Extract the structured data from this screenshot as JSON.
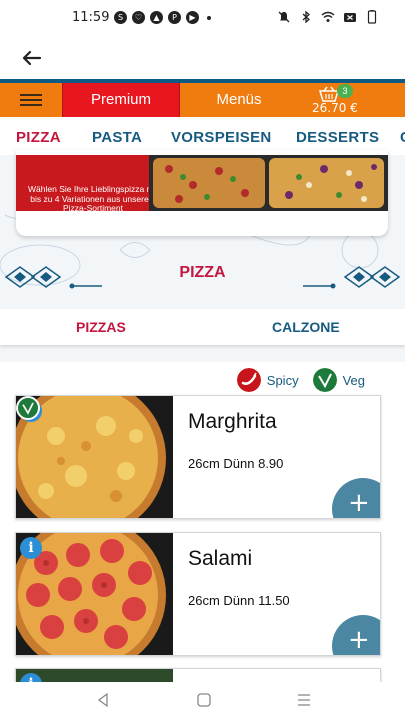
{
  "status_bar": {
    "time": "11:59",
    "apps": [
      "S",
      "♡",
      "▲",
      "P",
      "▶"
    ]
  },
  "navbar": {
    "premium_label": "Premium",
    "menus_label": "Menüs",
    "cart_count": "3",
    "cart_total": "26.70 €"
  },
  "categories": [
    "PIZZA",
    "PASTA",
    "VORSPEISEN",
    "DESSERTS"
  ],
  "banner": {
    "text": "Wählen Sie Ihre Lieblingspizza mit bis zu 4 Variationen aus unserem Pizza-Sortiment"
  },
  "section": {
    "title": "PIZZA"
  },
  "subtabs": {
    "pizzas": "PIZZAS",
    "calzone": "CALZONE"
  },
  "legend": {
    "spicy": "Spicy",
    "veg": "Veg"
  },
  "products": [
    {
      "name": "Marghrita",
      "price": "26cm Dünn 8.90",
      "info": "i",
      "add": "+"
    },
    {
      "name": "Salami",
      "price": "26cm Dünn 11.50",
      "info": "i",
      "add": "+"
    }
  ],
  "colors": {
    "accent_orange": "#f07b0e",
    "premium_red": "#e8171f",
    "category_blue": "#175b80",
    "active_crimson": "#c4173f",
    "add_button": "#4b86a3"
  }
}
